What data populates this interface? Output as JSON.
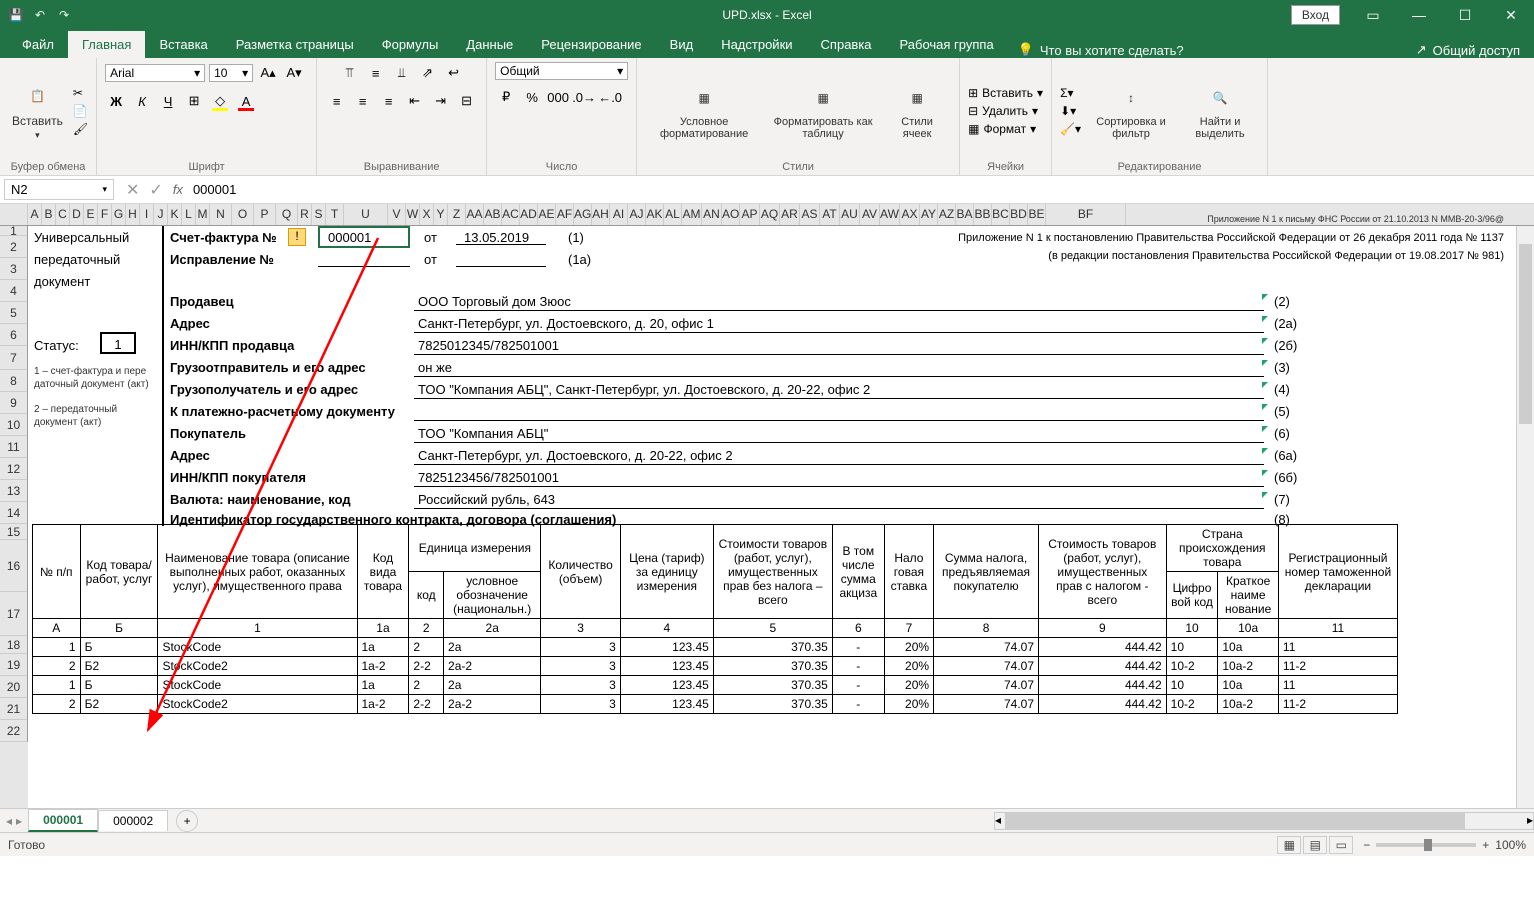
{
  "titlebar": {
    "title": "UPD.xlsx - Excel",
    "login": "Вход"
  },
  "tabs": [
    "Файл",
    "Главная",
    "Вставка",
    "Разметка страницы",
    "Формулы",
    "Данные",
    "Рецензирование",
    "Вид",
    "Надстройки",
    "Справка",
    "Рабочая группа"
  ],
  "active_tab": "Главная",
  "tellme": "Что вы хотите сделать?",
  "share": "Общий доступ",
  "ribbon": {
    "clipboard": {
      "paste": "Вставить",
      "label": "Буфер обмена"
    },
    "font": {
      "name": "Arial",
      "size": "10",
      "label": "Шрифт",
      "bold": "Ж",
      "italic": "К",
      "underline": "Ч"
    },
    "align": {
      "label": "Выравнивание"
    },
    "number": {
      "format": "Общий",
      "label": "Число"
    },
    "styles": {
      "cond": "Условное форматирование",
      "table": "Форматировать как таблицу",
      "cell": "Стили ячеек",
      "label": "Стили"
    },
    "cells": {
      "insert": "Вставить",
      "delete": "Удалить",
      "format": "Формат",
      "label": "Ячейки"
    },
    "editing": {
      "sort": "Сортировка и фильтр",
      "find": "Найти и выделить",
      "label": "Редактирование"
    }
  },
  "formula_bar": {
    "cell": "N2",
    "value": "000001"
  },
  "cols": [
    "A",
    "B",
    "C",
    "D",
    "E",
    "F",
    "G",
    "H",
    "I",
    "J",
    "K",
    "L",
    "M",
    "N",
    "O",
    "P",
    "Q",
    "R",
    "S",
    "T",
    "U",
    "V",
    "W",
    "X",
    "Y",
    "Z",
    "AA",
    "AB",
    "AC",
    "AD",
    "AE",
    "AF",
    "AG",
    "AH",
    "AI",
    "AJ",
    "AK",
    "AL",
    "AM",
    "AN",
    "AO",
    "AP",
    "AQ",
    "AR",
    "AS",
    "AT",
    "AU",
    "AV",
    "AW",
    "AX",
    "AY",
    "AZ",
    "BA",
    "BB",
    "BC",
    "BD",
    "BE",
    "BF"
  ],
  "rows": [
    1,
    2,
    3,
    4,
    5,
    6,
    7,
    8,
    9,
    10,
    11,
    12,
    13,
    14,
    15,
    16,
    17,
    18,
    19,
    20,
    21,
    22
  ],
  "doc": {
    "title_lines": [
      "Универсальный",
      "передаточный",
      "документ"
    ],
    "status_label": "Статус:",
    "status_value": "1",
    "status_notes": [
      "1 – счет-фактура и пере",
      "даточный документ (акт)",
      "2 – передаточный",
      "документ (акт)"
    ],
    "sf": "Счет-фактура №",
    "sf_no": "000001",
    "from": "от",
    "sf_date": "13.05.2019",
    "p1": "(1)",
    "isp": "Исправление №",
    "p1a": "(1а)",
    "appendix_top": "Приложение N 1 к письму ФНС России от 21.10.2013 N ММВ-20-3/96@",
    "appendix_1": "Приложение N 1 к постановлению Правительства Российской Федерации от 26 декабря 2011 года № 1137",
    "appendix_2": "(в редакции постановления Правительства Российской Федерации от 19.08.2017 № 981)",
    "seller": "Продавец",
    "seller_val": "ООО Торговый дом Зюос",
    "p2": "(2)",
    "addr": "Адрес",
    "addr_val": "Санкт-Петербург, ул. Достоевского, д. 20, офис 1",
    "p2a": "(2а)",
    "inn": "ИНН/КПП продавца",
    "inn_val": "7825012345/782501001",
    "p2b": "(2б)",
    "sender": "Грузоотправитель и его адрес",
    "sender_val": "он же",
    "p3": "(3)",
    "recv": "Грузополучатель и его адрес",
    "recv_val": "ТОО \"Компания АБЦ\", Санкт-Петербург, ул. Достоевского, д. 20-22, офис 2",
    "p4": "(4)",
    "paydoc": "К платежно-расчетному документу",
    "p5": "(5)",
    "buyer": "Покупатель",
    "buyer_val": "ТОО \"Компания АБЦ\"",
    "p6": "(6)",
    "baddr": "Адрес",
    "baddr_val": "Санкт-Петербург, ул. Достоевского, д. 20-22, офис 2",
    "p6a": "(6а)",
    "binn": "ИНН/КПП покупателя",
    "binn_val": "7825123456/782501001",
    "p6b": "(6б)",
    "cur": "Валюта: наименование, код",
    "cur_val": "Российский рубль, 643",
    "p7": "(7)",
    "ident": "Идентификатор государственного контракта, договора (соглашения)",
    "p8": "(8)"
  },
  "table": {
    "headers": {
      "npp": "№ п/п",
      "code": "Код товара/работ, услуг",
      "name": "Наименование товара (описание выполненных работ, оказанных услуг), имущественного права",
      "kind": "Код вида товара",
      "unit": "Единица измерения",
      "unit_code": "код",
      "unit_name": "условное обозначение (национальн.)",
      "qty": "Количество (объем)",
      "price": "Цена (тариф) за единицу измерения",
      "cost": "Стоимости товаров (работ, услуг), имущественных прав без налога – всего",
      "excise": "В том числе сумма акциза",
      "rate": "Нало говая ставка",
      "tax": "Сумма налога, предъявляемая покупателю",
      "total": "Стоимость товаров (работ, услуг), имущественных прав с налогом - всего",
      "country": "Страна происхождения товара",
      "ccode": "Цифро вой код",
      "cname": "Краткое наиме нование",
      "decl": "Регистрационный номер таможенной декларации"
    },
    "subheads": [
      "А",
      "Б",
      "1",
      "1а",
      "2",
      "2а",
      "3",
      "4",
      "5",
      "6",
      "7",
      "8",
      "9",
      "10",
      "10а",
      "11"
    ],
    "rows": [
      {
        "n": "1",
        "c": "Б",
        "name": "StockCode",
        "k": "1а",
        "uc": "2",
        "un": "2а",
        "q": "3",
        "p": "123.45",
        "cost": "370.35",
        "ex": "-",
        "r": "20%",
        "tax": "74.07",
        "tot": "444.42",
        "cc": "10",
        "cn": "10а",
        "d": "11"
      },
      {
        "n": "2",
        "c": "Б2",
        "name": "StockCode2",
        "k": "1а-2",
        "uc": "2-2",
        "un": "2а-2",
        "q": "3",
        "p": "123.45",
        "cost": "370.35",
        "ex": "-",
        "r": "20%",
        "tax": "74.07",
        "tot": "444.42",
        "cc": "10-2",
        "cn": "10а-2",
        "d": "11-2"
      },
      {
        "n": "1",
        "c": "Б",
        "name": "StockCode",
        "k": "1а",
        "uc": "2",
        "un": "2а",
        "q": "3",
        "p": "123.45",
        "cost": "370.35",
        "ex": "-",
        "r": "20%",
        "tax": "74.07",
        "tot": "444.42",
        "cc": "10",
        "cn": "10а",
        "d": "11"
      },
      {
        "n": "2",
        "c": "Б2",
        "name": "StockCode2",
        "k": "1а-2",
        "uc": "2-2",
        "un": "2а-2",
        "q": "3",
        "p": "123.45",
        "cost": "370.35",
        "ex": "-",
        "r": "20%",
        "tax": "74.07",
        "tot": "444.42",
        "cc": "10-2",
        "cn": "10а-2",
        "d": "11-2"
      }
    ]
  },
  "sheets": [
    "000001",
    "000002"
  ],
  "active_sheet": "000001",
  "status": "Готово",
  "zoom": "100%"
}
